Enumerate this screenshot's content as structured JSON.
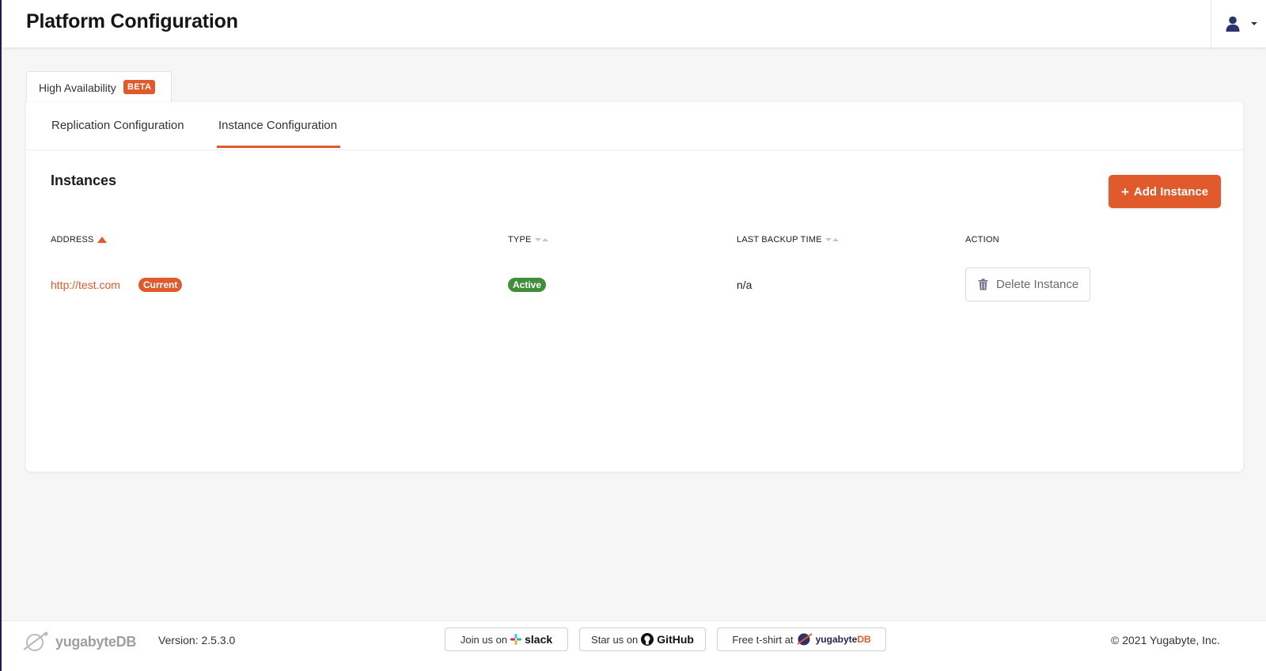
{
  "header": {
    "title": "Platform Configuration",
    "user_icon": "user-icon",
    "caret_icon": "caret-down-icon"
  },
  "outer_tab": {
    "label": "High Availability",
    "badge": "BETA"
  },
  "subtabs": [
    {
      "label": "Replication Configuration",
      "active": false
    },
    {
      "label": "Instance Configuration",
      "active": true
    }
  ],
  "instances": {
    "title": "Instances",
    "add_button": "Add Instance",
    "columns": {
      "address": "ADDRESS",
      "type": "TYPE",
      "last_backup_time": "LAST BACKUP TIME",
      "action": "ACTION"
    },
    "rows": [
      {
        "address": "http://test.com",
        "address_badge": "Current",
        "type": "Active",
        "last_backup_time": "n/a",
        "action_label": "Delete Instance"
      }
    ]
  },
  "footer": {
    "brand": "yugabyteDB",
    "version": "Version: 2.5.3.0",
    "slack_prefix": "Join us on",
    "slack_brand": "slack",
    "github_prefix": "Star us on",
    "github_brand": "GitHub",
    "shirt_prefix": "Free t-shirt at",
    "shirt_brand_a": "yugabyte",
    "shirt_brand_b": "DB",
    "copyright": "© 2021 Yugabyte, Inc."
  },
  "colors": {
    "accent": "#e05a2b",
    "success": "#3f8e3a",
    "background": "#f6f6f6"
  }
}
